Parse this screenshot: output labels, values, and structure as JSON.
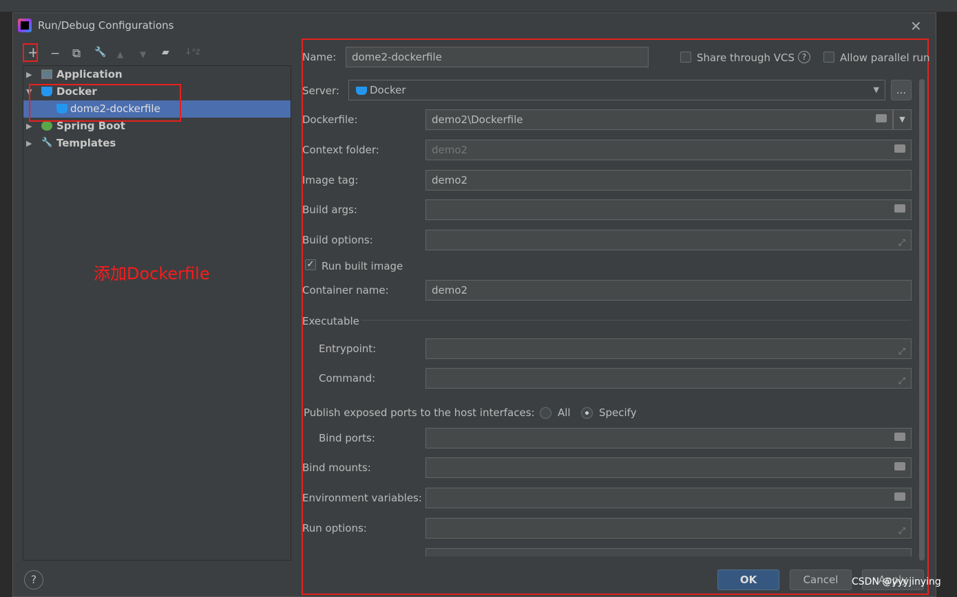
{
  "dialog": {
    "title": "Run/Debug Configurations",
    "close": "✕"
  },
  "toolbar": {
    "add": "+",
    "remove": "−",
    "copy": "⧉",
    "edit": "🔧",
    "up": "▲",
    "down": "▼",
    "folder": "▰",
    "sort": "↓ᵃz"
  },
  "tree": [
    {
      "label": "Application",
      "arrow": "▶"
    },
    {
      "label": "Docker",
      "arrow": "▼"
    },
    {
      "label": "dome2-dockerfile"
    },
    {
      "label": "Spring Boot",
      "arrow": "▶"
    },
    {
      "label": "Templates",
      "arrow": "▶"
    }
  ],
  "annotation": "添加Dockerfile",
  "help": "?",
  "form": {
    "name_label": "Name:",
    "name": "dome2-dockerfile",
    "share_vcs": "Share through VCS",
    "allow_parallel": "Allow parallel run",
    "server_label": "Server:",
    "server": "Docker",
    "more": "...",
    "dockerfile_label": "Dockerfile:",
    "dockerfile": "demo2\\Dockerfile",
    "context_label": "Context folder:",
    "context": "demo2",
    "image_tag_label": "Image tag:",
    "image_tag": "demo2",
    "build_args_label": "Build args:",
    "build_options_label": "Build options:",
    "run_built_image": "Run built image",
    "container_label": "Container name:",
    "container": "demo2",
    "executable": "Executable",
    "entrypoint_label": "Entrypoint:",
    "command_label": "Command:",
    "publish_label": "Publish exposed ports to the host interfaces:",
    "all": "All",
    "specify": "Specify",
    "bind_ports_label": "Bind ports:",
    "bind_mounts_label": "Bind mounts:",
    "env_label": "Environment variables:",
    "run_options_label": "Run options:"
  },
  "buttons": {
    "ok": "OK",
    "cancel": "Cancel",
    "apply": "Apply"
  },
  "watermark": "CSDN @yyyjinying",
  "colors": {
    "accent": "#4b6eaf",
    "highlight": "#e8201e",
    "docker": "#2496ed"
  }
}
